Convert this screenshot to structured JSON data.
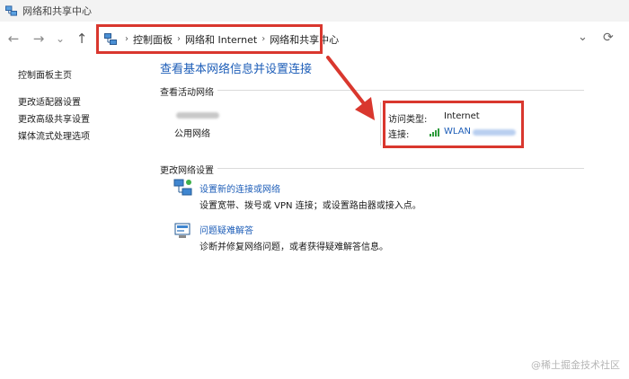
{
  "window": {
    "title": "网络和共享中心"
  },
  "navigation": {
    "back_icon": "←",
    "forward_icon": "→",
    "dropdown_icon": "⌄",
    "up_icon": "↑",
    "breadcrumb": [
      "控制面板",
      "网络和 Internet",
      "网络和共享中心"
    ],
    "separator": "›",
    "address_dropdown_icon": "⌄",
    "refresh_icon": "⟳"
  },
  "sidebar": {
    "items": [
      {
        "label": "控制面板主页"
      },
      {
        "label": "更改适配器设置"
      },
      {
        "label": "更改高级共享设置"
      },
      {
        "label": "媒体流式处理选项"
      }
    ]
  },
  "main": {
    "title": "查看基本网络信息并设置连接",
    "active_networks": {
      "heading": "查看活动网络",
      "network_type": "公用网络",
      "access_type_label": "访问类型:",
      "access_type_value": "Internet",
      "connection_label": "连接:",
      "connection_value": "WLAN"
    },
    "change_settings": {
      "heading": "更改网络设置",
      "tasks": [
        {
          "icon": "network-setup-icon",
          "title": "设置新的连接或网络",
          "description": "设置宽带、拨号或 VPN 连接；或设置路由器或接入点。"
        },
        {
          "icon": "troubleshoot-icon",
          "title": "问题疑难解答",
          "description": "诊断并修复网络问题，或者获得疑难解答信息。"
        }
      ]
    }
  },
  "annotation_color": "#d9372e",
  "link_color": "#1e5eb8",
  "watermark": "@稀土掘金技术社区"
}
